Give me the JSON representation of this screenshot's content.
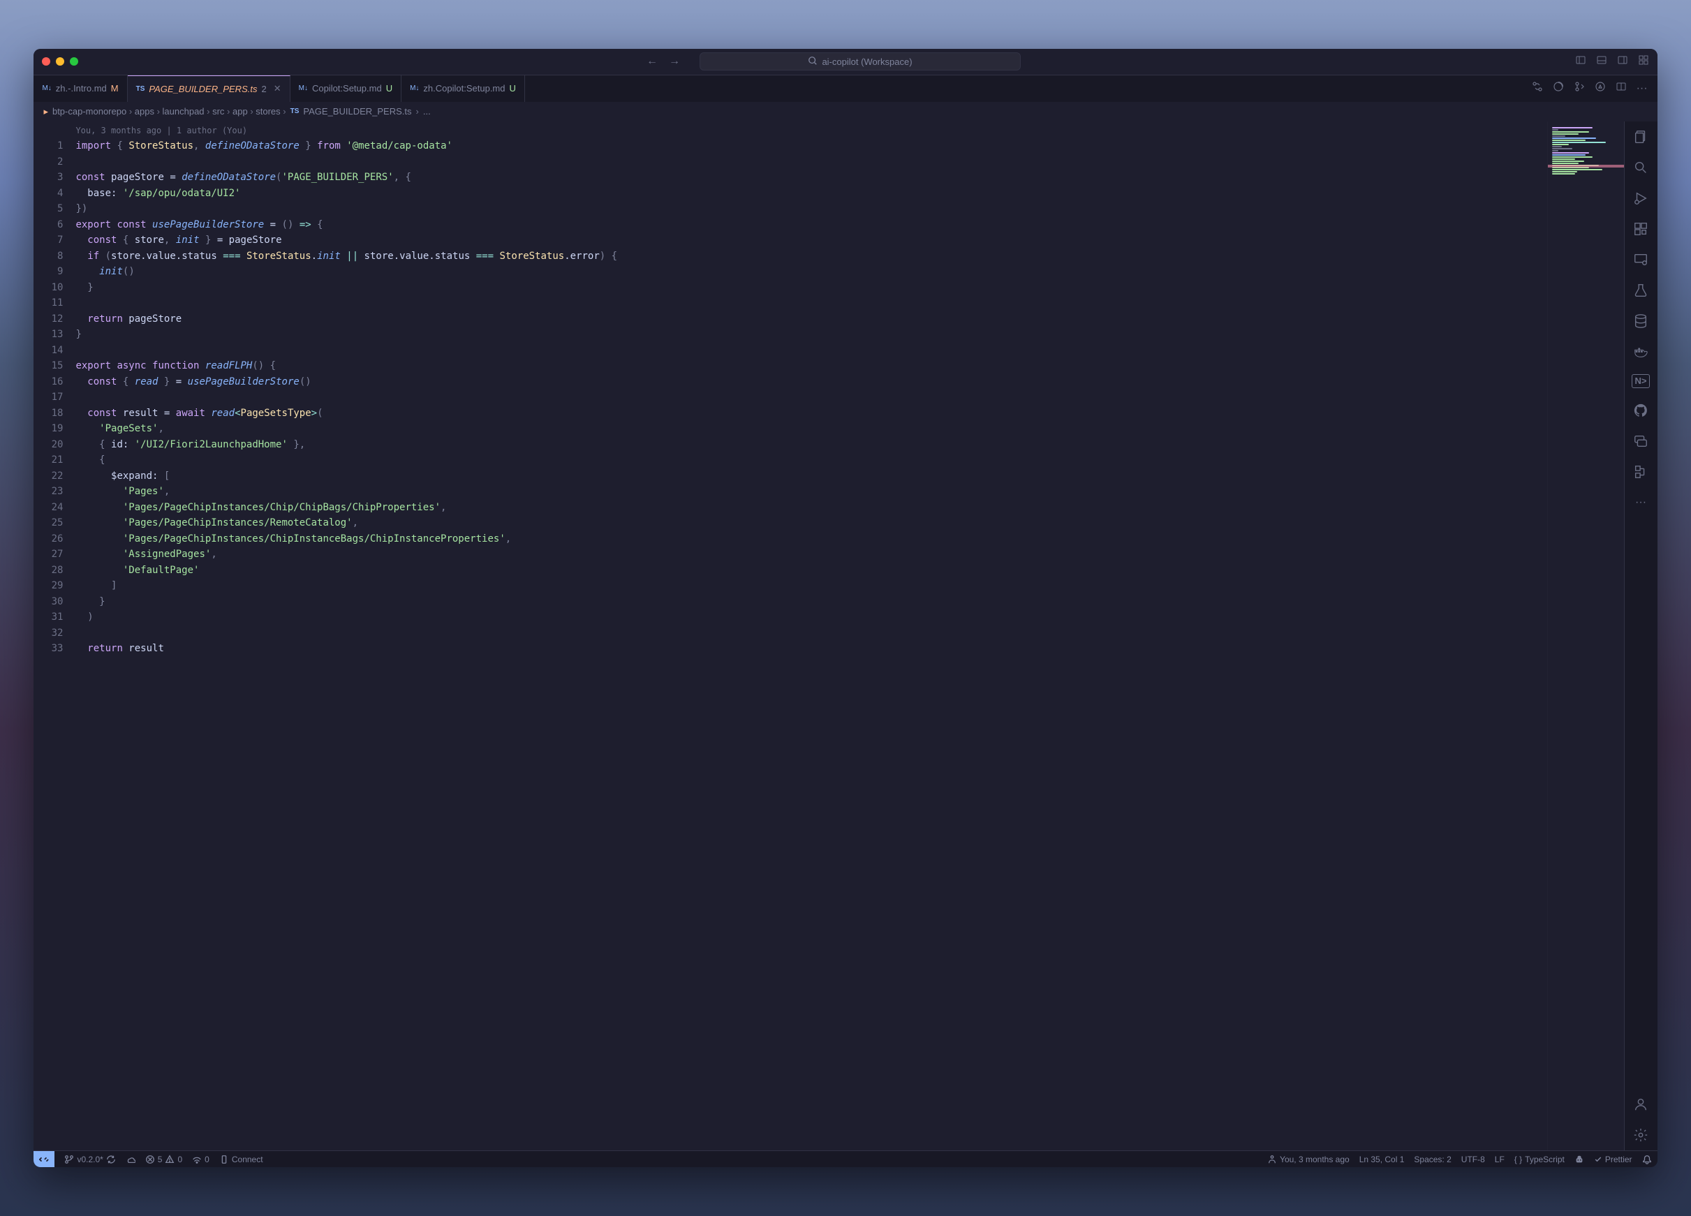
{
  "titlebar": {
    "workspace": "ai-copilot (Workspace)"
  },
  "tabs": [
    {
      "icon": "M↓",
      "name": "zh.-.Intro.md",
      "badge": "M",
      "badge_class": "badge-m"
    },
    {
      "icon": "TS",
      "name": "PAGE_BUILDER_PERS.ts",
      "badge_num": "2",
      "active": true,
      "italic": true,
      "closeable": true
    },
    {
      "icon": "M↓",
      "name": "Copilot:Setup.md",
      "badge": "U",
      "badge_class": "badge-u"
    },
    {
      "icon": "M↓",
      "name": "zh.Copilot:Setup.md",
      "badge": "U",
      "badge_class": "badge-u"
    }
  ],
  "breadcrumb": {
    "parts": [
      "btp-cap-monorepo",
      "apps",
      "launchpad",
      "src",
      "app",
      "stores"
    ],
    "file_icon": "TS",
    "file": "PAGE_BUILDER_PERS.ts",
    "tail": "..."
  },
  "blame": "You, 3 months ago | 1 author (You)",
  "code_lines": [
    "import { StoreStatus, defineODataStore } from '@metad/cap-odata'",
    "",
    "const pageStore = defineODataStore('PAGE_BUILDER_PERS', {",
    "  base: '/sap/opu/odata/UI2'",
    "})",
    "export const usePageBuilderStore = () => {",
    "  const { store, init } = pageStore",
    "  if (store.value.status === StoreStatus.init || store.value.status === StoreStatus.error) {",
    "    init()",
    "  }",
    "",
    "  return pageStore",
    "}",
    "",
    "export async function readFLPH() {",
    "  const { read } = usePageBuilderStore()",
    "",
    "  const result = await read<PageSetsType>(",
    "    'PageSets',",
    "    { id: '/UI2/Fiori2LaunchpadHome' },",
    "    {",
    "      $expand: [",
    "        'Pages',",
    "        'Pages/PageChipInstances/Chip/ChipBags/ChipProperties',",
    "        'Pages/PageChipInstances/RemoteCatalog',",
    "        'Pages/PageChipInstances/ChipInstanceBags/ChipInstanceProperties',",
    "        'AssignedPages',",
    "        'DefaultPage'",
    "      ]",
    "    }",
    "  )",
    "",
    "  return result"
  ],
  "statusbar": {
    "branch": "v0.2.0*",
    "sync": "",
    "errors": "5",
    "warnings": "0",
    "port": "0",
    "connect": "Connect",
    "blame": "You, 3 months ago",
    "cursor": "Ln 35, Col 1",
    "spaces": "Spaces: 2",
    "encoding": "UTF-8",
    "eol": "LF",
    "lang": "TypeScript",
    "formatter": "Prettier"
  }
}
